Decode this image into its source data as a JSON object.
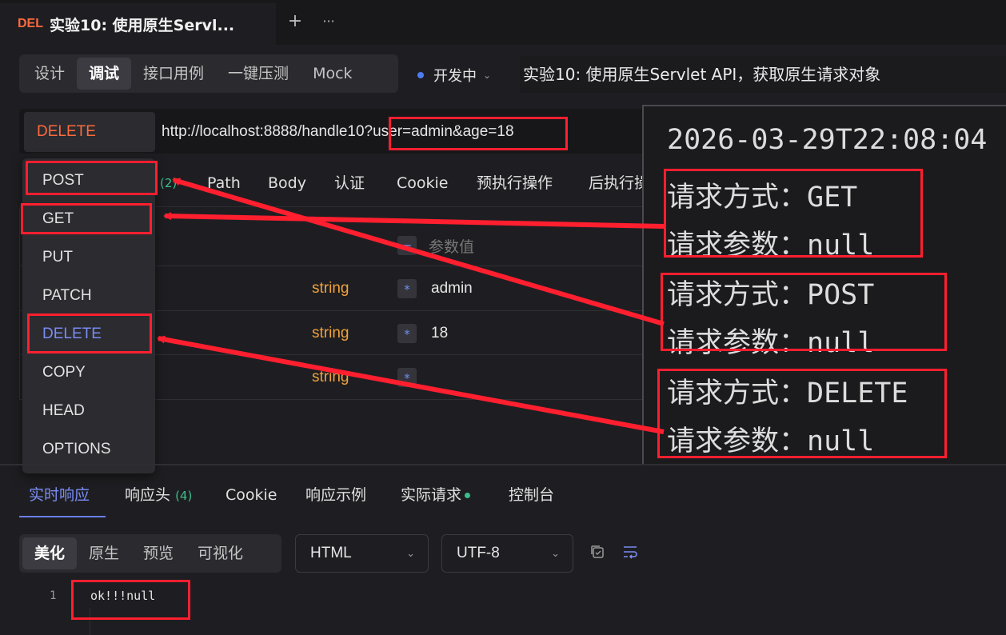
{
  "titlebar": {
    "tab_method": "DEL",
    "tab_title": "实验10: 使用原生Servl...",
    "plus_icon": "+",
    "more_icon": "···"
  },
  "modes": [
    "设计",
    "调试",
    "接口用例",
    "一键压测",
    "Mock"
  ],
  "active_mode": "调试",
  "status": {
    "label": "开发中",
    "dot_color": "#4d7bf3"
  },
  "api_name": "实验10: 使用原生Servlet API，获取原生请求对象",
  "request": {
    "method": "DELETE",
    "url": "http://localhost:8888/handle10?user=admin&age=18"
  },
  "request_tabs": {
    "count": "(2)",
    "path": "Path",
    "body": "Body",
    "auth": "认证",
    "cookie": "Cookie",
    "pre": "预执行操作",
    "post": "后执行操作"
  },
  "params": {
    "value_placeholder": "参数值",
    "rows": [
      {
        "type": "string",
        "value": "admin"
      },
      {
        "type": "string",
        "value": "18"
      },
      {
        "type": "string",
        "value": ""
      }
    ]
  },
  "method_options": [
    "POST",
    "GET",
    "PUT",
    "PATCH",
    "DELETE",
    "COPY",
    "HEAD",
    "OPTIONS"
  ],
  "selected_method": "DELETE",
  "console": {
    "timestamp": "2026-03-29T22:08:04",
    "lines": [
      "请求方式：GET",
      "请求参数：null",
      "请求方式：POST",
      "请求参数：null",
      "请求方式：DELETE",
      "请求参数：null"
    ]
  },
  "response_tabs": {
    "realtime": "实时响应",
    "headers": "响应头",
    "headers_count": "(4)",
    "cookie": "Cookie",
    "example": "响应示例",
    "actual": "实际请求",
    "console": "控制台"
  },
  "view_modes": [
    "美化",
    "原生",
    "预览",
    "可视化"
  ],
  "active_view": "美化",
  "format": "HTML",
  "encoding": "UTF-8",
  "response_body": {
    "line_number": "1",
    "text": "ok!!!null"
  },
  "colors": {
    "accent": "#7a8cf3",
    "method_delete": "#ff6a3d",
    "annotation": "#ff1f2f",
    "type_string": "#f0a23c",
    "success": "#3bbf8a"
  }
}
